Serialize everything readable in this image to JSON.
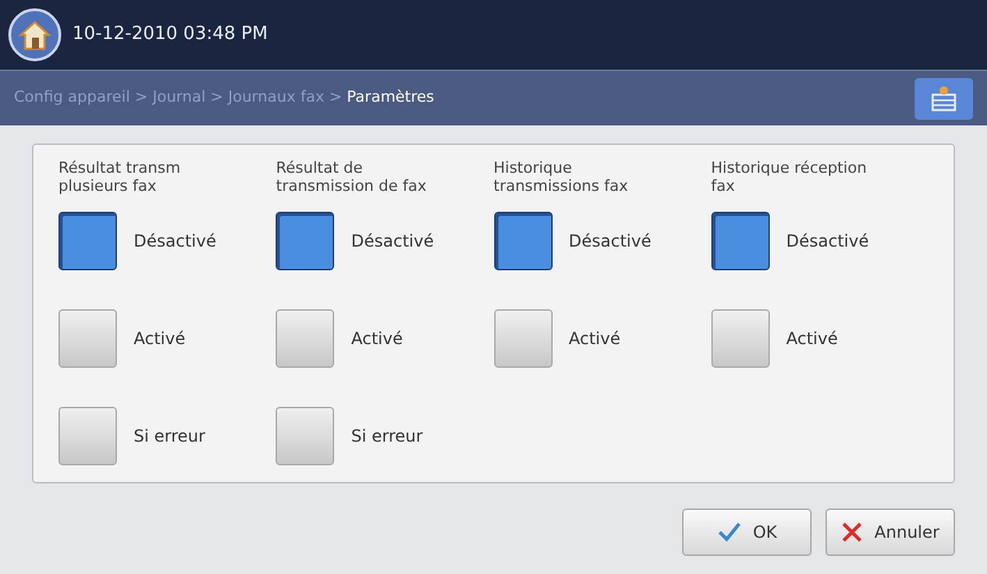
{
  "header": {
    "datetime": "10-12-2010 03:48 PM"
  },
  "breadcrumb": {
    "path": "Config appareil > Journal > Journaux fax > ",
    "current": "Paramètres"
  },
  "columns": [
    {
      "title": "Résultat transm plusieurs fax",
      "options": [
        {
          "label": "Désactivé",
          "selected": true
        },
        {
          "label": "Activé",
          "selected": false
        },
        {
          "label": "Si erreur",
          "selected": false
        }
      ]
    },
    {
      "title": "Résultat de transmission de fax",
      "options": [
        {
          "label": "Désactivé",
          "selected": true
        },
        {
          "label": "Activé",
          "selected": false
        },
        {
          "label": "Si erreur",
          "selected": false
        }
      ]
    },
    {
      "title": "Historique transmissions fax",
      "options": [
        {
          "label": "Désactivé",
          "selected": true
        },
        {
          "label": "Activé",
          "selected": false
        }
      ]
    },
    {
      "title": "Historique réception fax",
      "options": [
        {
          "label": "Désactivé",
          "selected": true
        },
        {
          "label": "Activé",
          "selected": false
        }
      ]
    }
  ],
  "buttons": [
    {
      "kind": "ok",
      "label": "OK"
    },
    {
      "kind": "cancel",
      "label": "Annuler"
    }
  ]
}
